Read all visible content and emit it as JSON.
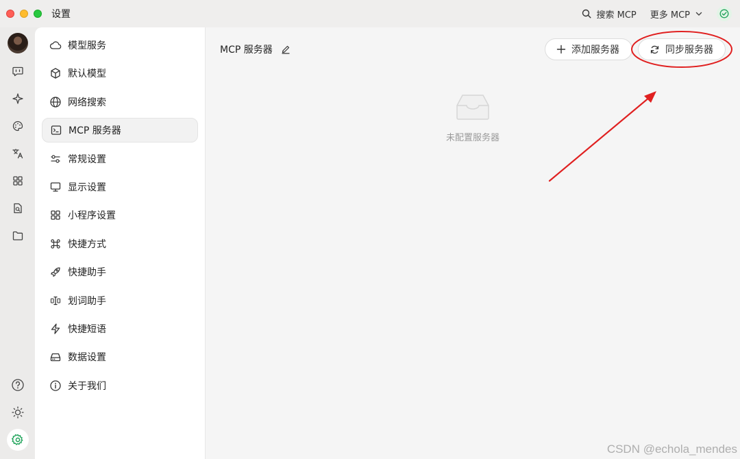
{
  "window": {
    "title": "设置"
  },
  "topbar": {
    "search_label": "搜索 MCP",
    "more_label": "更多 MCP"
  },
  "rail": {
    "icons": [
      "chat-icon",
      "sparkle-icon",
      "palette-icon",
      "translate-icon",
      "apps-grid-icon",
      "file-search-icon",
      "folder-icon"
    ],
    "bottom_icons": [
      "help-icon",
      "theme-icon",
      "settings-gear-icon"
    ]
  },
  "nav": {
    "items": [
      {
        "label": "模型服务",
        "icon": "cloud-icon"
      },
      {
        "label": "默认模型",
        "icon": "cube-icon"
      },
      {
        "label": "网络搜索",
        "icon": "globe-icon"
      },
      {
        "label": "MCP 服务器",
        "icon": "terminal-icon",
        "active": true
      },
      {
        "label": "常规设置",
        "icon": "sliders-icon"
      },
      {
        "label": "显示设置",
        "icon": "monitor-icon"
      },
      {
        "label": "小程序设置",
        "icon": "grid-icon"
      },
      {
        "label": "快捷方式",
        "icon": "command-icon"
      },
      {
        "label": "快捷助手",
        "icon": "rocket-icon"
      },
      {
        "label": "划词助手",
        "icon": "text-cursor-icon"
      },
      {
        "label": "快捷短语",
        "icon": "zap-icon"
      },
      {
        "label": "数据设置",
        "icon": "hard-drive-icon"
      },
      {
        "label": "关于我们",
        "icon": "info-icon"
      }
    ]
  },
  "main": {
    "title": "MCP 服务器",
    "add_button": "添加服务器",
    "sync_button": "同步服务器",
    "empty_text": "未配置服务器"
  },
  "watermark": "CSDN @echola_mendes",
  "colors": {
    "accent_green": "#1fa35a",
    "annotation_red": "#e02020"
  }
}
